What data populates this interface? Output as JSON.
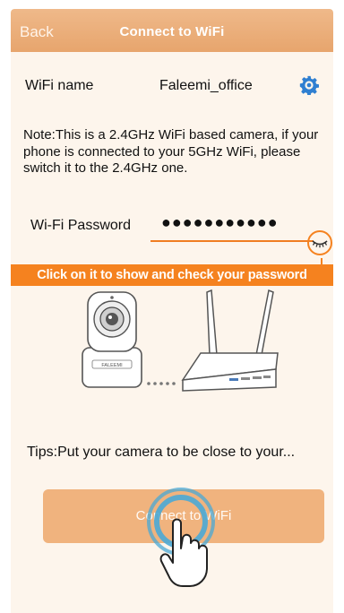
{
  "nav": {
    "back_label": "Back",
    "title": "Connect to WiFi"
  },
  "wifi": {
    "label": "WiFi name",
    "name": "Faleemi_office"
  },
  "note": "Note:This is a 2.4GHz WiFi based camera, if your phone is connected to your 5GHz WiFi, please switch it to the 2.4GHz one.",
  "password": {
    "label": "Wi-Fi Password",
    "masked_value": "●●●●●●●●●●●"
  },
  "hint": "Click on it to show and check your password",
  "camera_brand": "FALEEMI",
  "tips": "Tips:Put your camera to be close to your...",
  "connect_button": "Connect to WiFi",
  "colors": {
    "nav_bg": "#e7a56d",
    "page_bg": "#fdf5ec",
    "accent": "#f5821f",
    "button_bg": "#f0b37e",
    "gear": "#2f7fd1",
    "tap_ring": "#4aa8d6"
  },
  "icons": [
    "gear-icon",
    "eye-closed-icon",
    "arrow-down-icon",
    "camera-icon",
    "router-icon",
    "hand-pointer-icon"
  ]
}
